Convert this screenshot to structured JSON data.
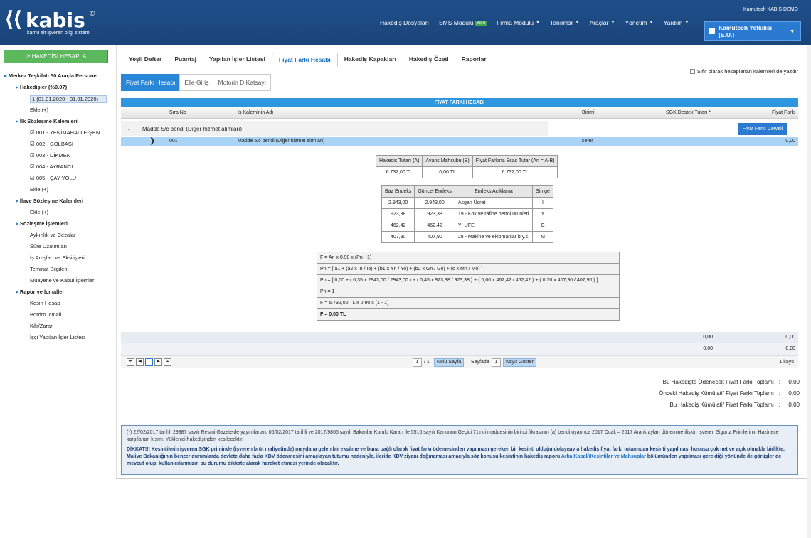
{
  "header": {
    "logo_text": "kabis",
    "logo_mark": "©",
    "logo_sub": "kamu alt işveren bilgi sistemi",
    "company": "Kamutech KABİS DEMO",
    "nav": [
      {
        "label": "Hakediş Dosyaları",
        "has_caret": false
      },
      {
        "label": "SMS Modülü",
        "badge": "Yeni",
        "has_caret": false
      },
      {
        "label": "Firma Modülü",
        "has_caret": true
      },
      {
        "label": "Tanımlar",
        "has_caret": true
      },
      {
        "label": "Araçlar",
        "has_caret": true
      },
      {
        "label": "Yönetim",
        "has_caret": true
      },
      {
        "label": "Yardım",
        "has_caret": true
      }
    ],
    "user_line1": "Kamutech Yetkilisi",
    "user_line2": "(E.U.)"
  },
  "sidebar": {
    "calc_button": "HAKEDİŞİ HESAPLA",
    "tree": [
      {
        "label": "Merkez Teşkilatı 50 Araçla Persone",
        "level": 0,
        "bold": true
      },
      {
        "label": "Hakedişler (%0.07)",
        "level": 1,
        "bold": true
      },
      {
        "label": "1 (01.01.2020 - 31.01.2020)",
        "level": 2,
        "selected": true
      },
      {
        "label": "Ekle (+)",
        "level": 2
      },
      {
        "label": "İlk Sözleşme Kalemleri",
        "level": 1,
        "bold": true
      },
      {
        "label": "001 - YENİMAHALLE-ŞEN",
        "level": 2,
        "check": true
      },
      {
        "label": "002 - GÖLBAŞI",
        "level": 2,
        "check": true
      },
      {
        "label": "003 - DİKMEN",
        "level": 2,
        "check": true
      },
      {
        "label": "004 - AYRANCI",
        "level": 2,
        "check": true
      },
      {
        "label": "005 - ÇAY YOLU",
        "level": 2,
        "check": true
      },
      {
        "label": "Ekle (+)",
        "level": 2
      },
      {
        "label": "İlave Sözleşme Kalemleri",
        "level": 1,
        "bold": true
      },
      {
        "label": "Ekle (+)",
        "level": 2
      },
      {
        "label": "Sözleşme İşlemleri",
        "level": 1,
        "bold": true
      },
      {
        "label": "Aykırılık ve Cezalar",
        "level": 2
      },
      {
        "label": "Süre Uzatımları",
        "level": 2
      },
      {
        "label": "İş Artışları ve Eksilişleri",
        "level": 2
      },
      {
        "label": "Teminat Bilgileri",
        "level": 2
      },
      {
        "label": "Muayene ve Kabul İşlemleri",
        "level": 2
      },
      {
        "label": "Rapor ve İcmaller",
        "level": 1,
        "bold": true
      },
      {
        "label": "Kesin Hesap",
        "level": 2
      },
      {
        "label": "Bordro İcmali",
        "level": 2
      },
      {
        "label": "Kâr/Zarar",
        "level": 2
      },
      {
        "label": "İşçi Yapılan İşler Listesi",
        "level": 2
      }
    ]
  },
  "tabs": [
    "Yeşil Defter",
    "Puantaj",
    "Yapılan İşler Listesi",
    "Fiyat Farkı Hesabı",
    "Hakediş Kapakları",
    "Hakediş Özeti",
    "Raporlar"
  ],
  "active_tab": 3,
  "zero_print_label": "Sıfır olarak hesaplanan kalemleri de yazdır",
  "subtabs": [
    "Fiyat Farkı Hesabı",
    "Elle Giriş",
    "Motorin D Katsayı"
  ],
  "grid": {
    "title": "FİYAT FARKI HESABI",
    "headers": {
      "sira": "Sıra No",
      "kalem": "İş Kaleminin Adı",
      "birim": "Birimi",
      "sgk": "SGK Destek Tutarı *",
      "fiyat": "Fiyat Farkı"
    },
    "group_label": "Madde 5/c bendi (Diğer hizmet alımları)",
    "group_button": "Fiyat Farkı Cetveli",
    "row": {
      "sira": "001",
      "kalem": "Madde 5/c bendi (Diğer hizmet alımları)",
      "birim": "sefer",
      "fiyat": "0,00"
    },
    "summary1": {
      "a": "0,00",
      "b": "0,00"
    },
    "summary2": {
      "a": "0,00",
      "b": "0,00"
    }
  },
  "hakedis_table": {
    "headers": [
      "Hakediş Tutarı (A)",
      "Avans Mahsubu (B)",
      "Fiyat Farkına Esas Tutar (An = A-B)"
    ],
    "values": [
      "6.732,00 TL",
      "0,00 TL",
      "6.732,00 TL"
    ]
  },
  "endeks_table": {
    "headers": [
      "Baz Endeks",
      "Güncel Endeks",
      "Endeks Açıklama",
      "Simge"
    ],
    "rows": [
      [
        "2.943,00",
        "2.943,00",
        "Asgari Ücret",
        "I"
      ],
      [
        "923,38",
        "923,38",
        "19 - Kok ve rafine petrol ürünleri",
        "Y"
      ],
      [
        "462,42",
        "462,42",
        "Yİ-ÜFE",
        "G"
      ],
      [
        "407,90",
        "407,90",
        "28 - Makine ve ekipmanlar b.y.s.",
        "M"
      ]
    ]
  },
  "formula_lines": [
    "F = An x 0,90 x (Pn - 1)",
    "Pn = [ a1 + (a2 x In / Io) + (b1 x Yn / Yo) + (b2 x Gn / Go) + (c x Mn / Mo) ]",
    "Pn = [ 0,00 + ( 0,35 x 2943,00 / 2943,00 ) + ( 0,45 x 923,38 / 923,38 ) + ( 0,00 x 462,42 / 462,42 ) + ( 0,20 x 407,90 / 407,90 ) ]",
    "Pn = 1",
    "F = 6.732,00 TL x 0,90 x (1 - 1)",
    "F = 0,00 TL"
  ],
  "pager": {
    "page": "1",
    "of": "/ 1",
    "goto_label": "Nolu Sayfa",
    "per_page_label": "Sayfada",
    "per_page": "1",
    "show_label": "Kayıt Göster",
    "count": "1 kayıt"
  },
  "totals": [
    {
      "label": "Bu Hakedişte Ödenecek Fiyat Farkı Toplamı",
      "value": "0,00"
    },
    {
      "label": "Önceki Hakediş Kümülatif Fiyat Farkı Toplamı",
      "value": "0,00"
    },
    {
      "label": "Bu Hakediş Kümülatif Fiyat Farkı Toplamı",
      "value": "0,00"
    }
  ],
  "note": {
    "p1": "(*) 22/02/2017 tarihli 29987 sayılı Resmi Gazete'de yayımlanan, 06/02/2017 tarihli ve 2017/9865 sayılı Bakanlar Kurulu Kararı ile 5510 sayılı Kanunun Geçici 71'nci maddesinin birinci fıkrasının (a) bendi uyarınca 2017 Ocak – 2017 Aralık ayları dönemine ilişkin İşveren Sigorta Primlerinin Hazinece karşılanan kısmı, Yüklenici hakedişinden kesilecektir.",
    "warn": "DİKKAT!!! Kesintilerin işveren SGK priminde (işveren brüt maliyetinde) meydana gelen bir eksilme ve buna bağlı olarak fiyat farkı ödemesinden yapılması gereken bir kesinti olduğu dolayısıyla hakediş fiyat farkı tutarından kesinti yapılması hususu çok net ve açık olmakla birlikte, Maliye Bakanlığının benzer durumlarda devlete daha fazla KDV ödenmesini amaçlayan tutumu nedeniyle, ileride KDV ziyanı doğmaması amacıyla söz konusu kesintinin hakediş raporu ",
    "link": "Arka Kapak\\Kesintiler ve Mahsuplar",
    "warn2": " bölümünden yapılması gerektiği yönünde de görüşler de mevcut olup, kullanıcılarımızın bu durumu dikkate alarak hareket etmesi yerinde olacaktır."
  }
}
